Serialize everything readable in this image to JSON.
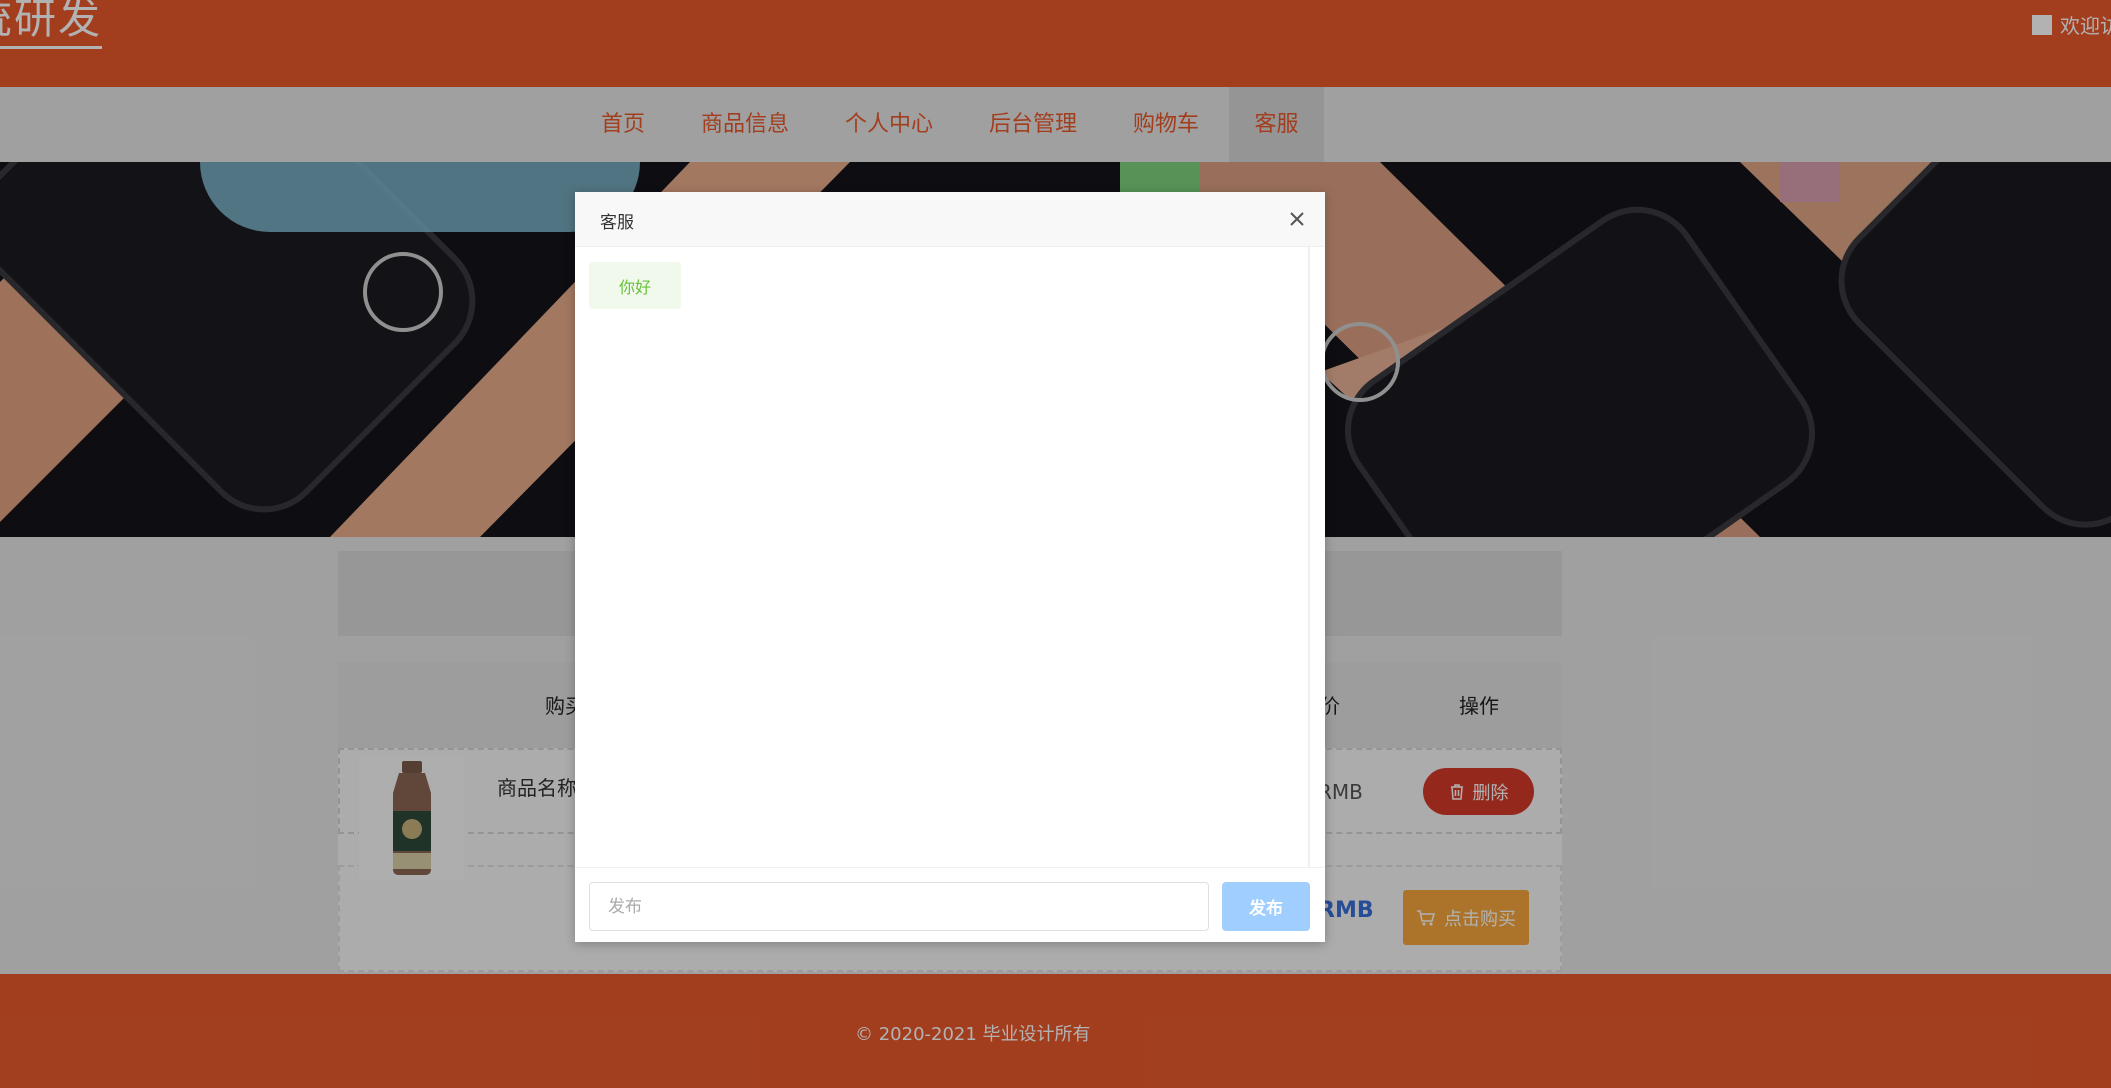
{
  "header": {
    "site_title": "统研发",
    "welcome_text": "欢迎访"
  },
  "nav": {
    "items": [
      {
        "label": "首页"
      },
      {
        "label": "商品信息"
      },
      {
        "label": "个人中心"
      },
      {
        "label": "后台管理"
      },
      {
        "label": "购物车"
      },
      {
        "label": "客服"
      }
    ],
    "active": "客服"
  },
  "cart": {
    "columns": [
      "购买",
      "价",
      "操作"
    ],
    "row": {
      "product_name": "商品名称",
      "price": "RMB",
      "delete_label": "删除"
    },
    "total": "RMB",
    "buy_label": "点击购买"
  },
  "footer": {
    "copyright": "© 2020-2021 毕业设计所有"
  },
  "dialog": {
    "title": "客服",
    "messages": [
      {
        "text": "你好"
      }
    ],
    "input_placeholder": "发布",
    "send_label": "发布"
  },
  "colors": {
    "brand": "#e85a2c",
    "delete": "#d63a2a",
    "buy": "#f7a63d",
    "send": "#a0cfff",
    "message_bg": "#f0f9eb",
    "message_text": "#67c23a"
  },
  "icons": {
    "close": "close-icon",
    "trash": "trash-icon",
    "cart": "cart-icon"
  }
}
